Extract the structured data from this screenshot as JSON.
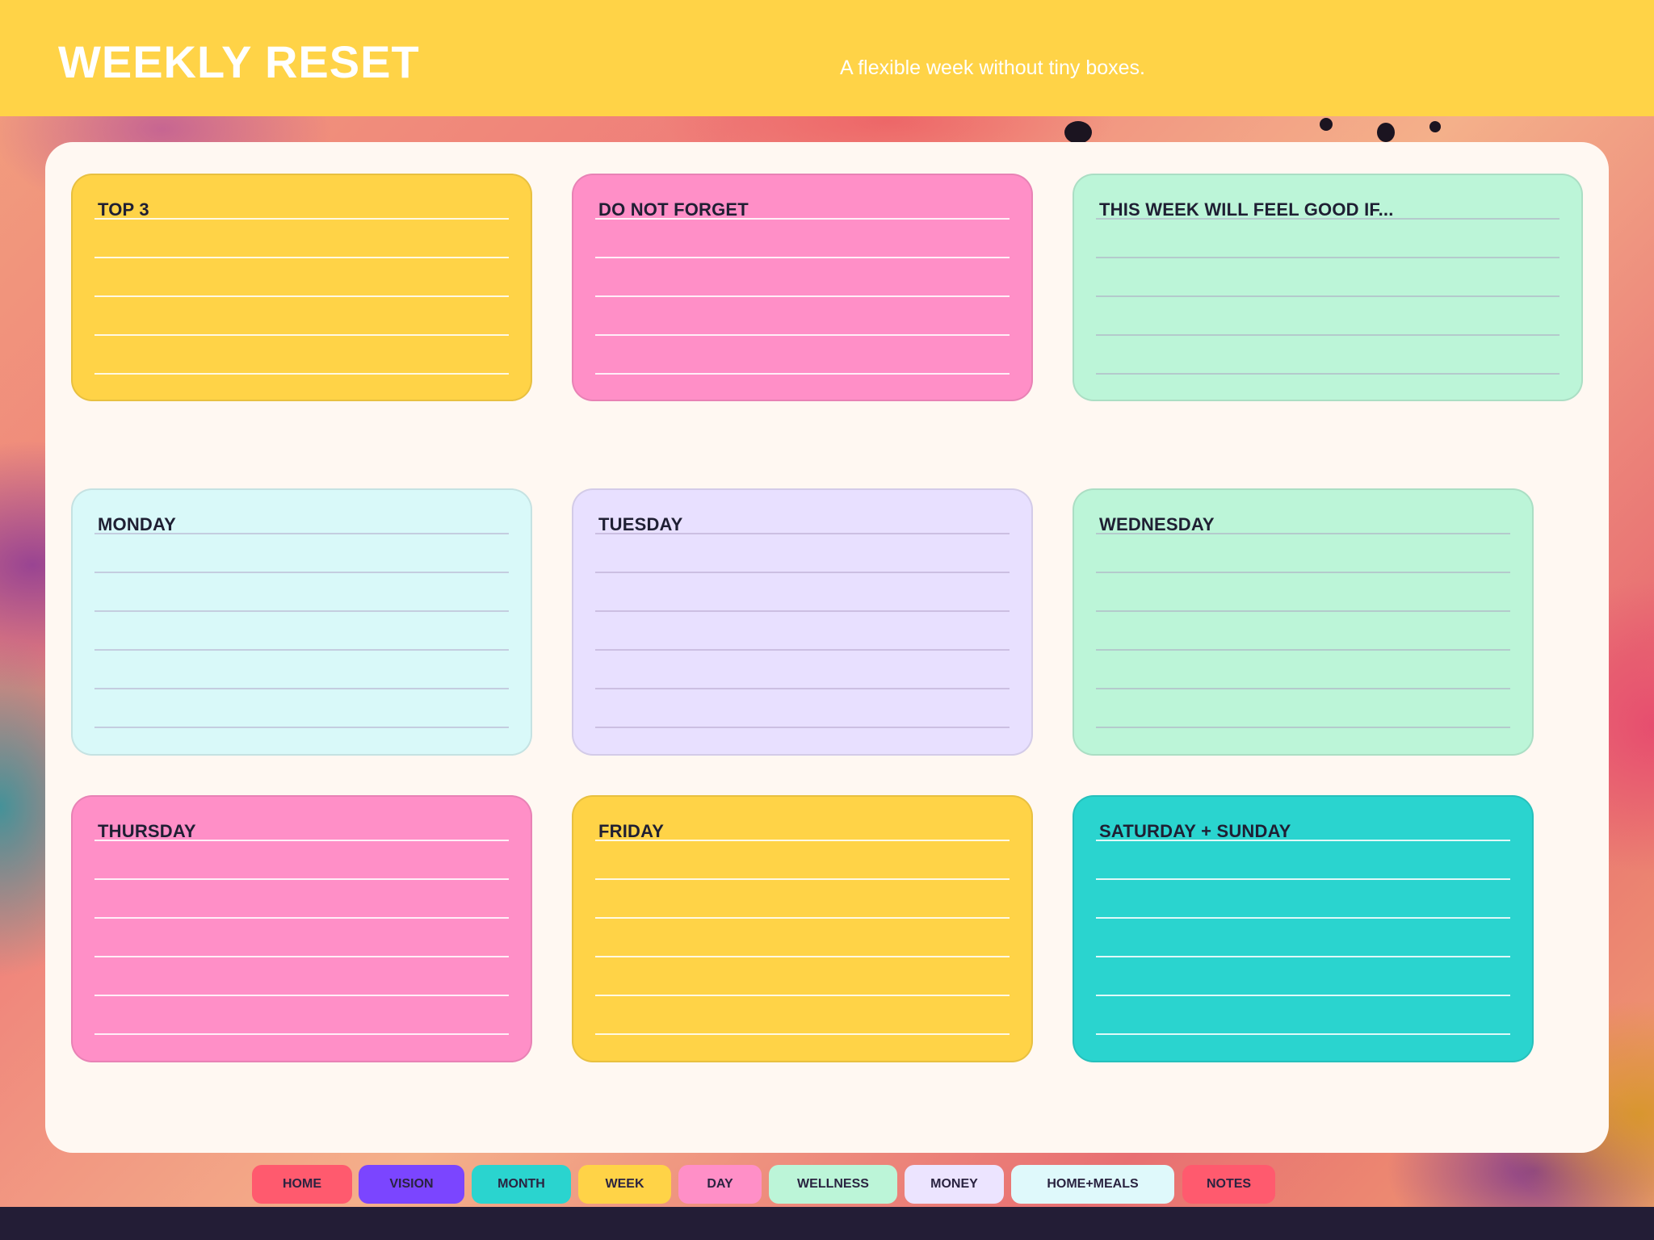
{
  "header": {
    "title": "WEEKLY RESET",
    "subtitle": "A flexible week without tiny boxes."
  },
  "cards": [
    {
      "name": "card-top-3",
      "title": "TOP 3",
      "color": "#ffd347",
      "lines": 5
    },
    {
      "name": "card-do-not-forget",
      "title": "DO NOT FORGET",
      "color": "#ff8fc7",
      "lines": 5
    },
    {
      "name": "card-feel-good",
      "title": "THIS WEEK WILL FEEL GOOD IF...",
      "color": "#bcf5d8",
      "lines": 5
    },
    {
      "name": "card-monday",
      "title": "MONDAY",
      "color": "#d9f9f9",
      "lines": 6
    },
    {
      "name": "card-tuesday",
      "title": "TUESDAY",
      "color": "#e8e0ff",
      "lines": 6
    },
    {
      "name": "card-wednesday",
      "title": "WEDNESDAY",
      "color": "#bcf5d8",
      "lines": 6
    },
    {
      "name": "card-thursday",
      "title": "THURSDAY",
      "color": "#ff8fc7",
      "lines": 6
    },
    {
      "name": "card-friday",
      "title": "FRIDAY",
      "color": "#ffd347",
      "lines": 6
    },
    {
      "name": "card-weekend",
      "title": "SATURDAY + SUNDAY",
      "color": "#2ad4cf",
      "lines": 6
    }
  ],
  "nav": [
    {
      "label": "HOME",
      "color": "#ff5a6e"
    },
    {
      "label": "VISION",
      "color": "#7b45ff"
    },
    {
      "label": "MONTH",
      "color": "#2ad4cf"
    },
    {
      "label": "WEEK",
      "color": "#ffd347"
    },
    {
      "label": "DAY",
      "color": "#ff8fc7"
    },
    {
      "label": "WELLNESS",
      "color": "#bcf5d8"
    },
    {
      "label": "MONEY",
      "color": "#ece4ff"
    },
    {
      "label": "HOME+MEALS",
      "color": "#dff9fb"
    },
    {
      "label": "NOTES",
      "color": "#ff5a6e"
    }
  ],
  "colors": {
    "header": "#ffd347",
    "panel": "#fff8f2",
    "footer": "#231d36",
    "title_text": "#ffffff",
    "card_text": "#1f1f33"
  }
}
